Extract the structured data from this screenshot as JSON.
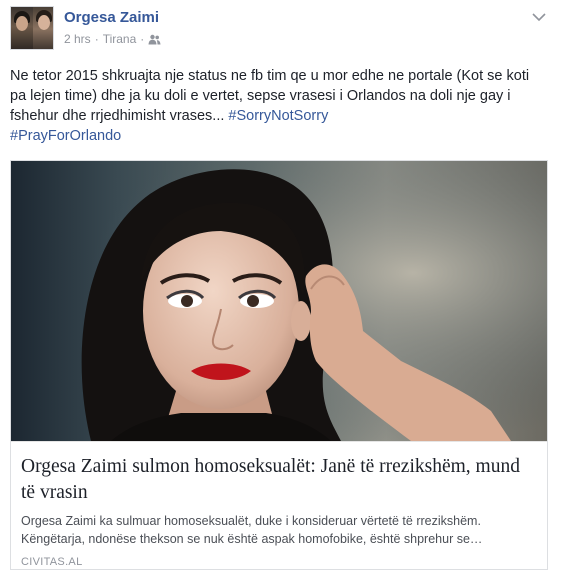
{
  "post": {
    "author": "Orgesa Zaimi",
    "time": "2 hrs",
    "location": "Tirana",
    "separator": "·",
    "privacy_icon": "friends-icon",
    "menu_icon": "chevron-down-icon",
    "text_main": "Ne tetor 2015 shkruajta nje status ne fb tim qe u mor edhe ne portale (Kot se koti pa lejen time) dhe ja ku doli e vertet, sepse vrasesi i Orlandos na doli nje gay i fshehur dhe rrjedhimisht vrases... ",
    "hashtag_1": "#SorryNotSorry",
    "hashtag_2": "#PrayForOrlando"
  },
  "link_card": {
    "title": "Orgesa Zaimi sulmon homoseksualët: Janë të rrezikshëm, mund të vrasin",
    "description": "Orgesa Zaimi ka sulmuar homoseksualët, duke i konsideruar vërtetë të rrezikshëm. Këngëtarja, ndonëse thekson se nuk është aspak homofobike, është shprehur se…",
    "source": "CIVITAS.AL"
  },
  "colors": {
    "link_blue": "#365899",
    "text": "#1d2129",
    "muted": "#90949c"
  }
}
